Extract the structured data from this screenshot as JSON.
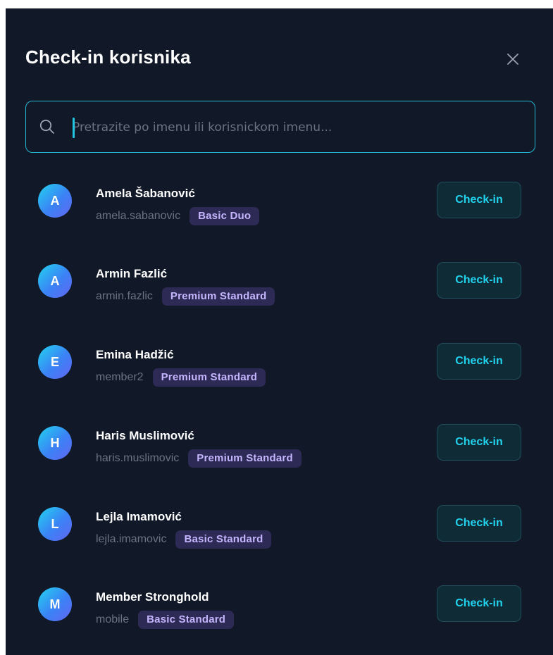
{
  "modal": {
    "title": "Check-in korisnika",
    "close_icon": "close-icon"
  },
  "search": {
    "placeholder": "Pretrazite po imenu ili korisnickom imenu...",
    "value": "",
    "icon": "search-icon"
  },
  "colors": {
    "background": "#111827",
    "accent": "#22d3ee",
    "badge_bg": "#2d2a55",
    "badge_text": "#c4b5fd"
  },
  "checkin_label": "Check-in",
  "users": [
    {
      "initial": "A",
      "name": "Amela Šabanović",
      "username": "amela.sabanovic",
      "plan": "Basic Duo"
    },
    {
      "initial": "A",
      "name": "Armin Fazlić",
      "username": "armin.fazlic",
      "plan": "Premium Standard"
    },
    {
      "initial": "E",
      "name": "Emina Hadžić",
      "username": "member2",
      "plan": "Premium Standard"
    },
    {
      "initial": "H",
      "name": "Haris Muslimović",
      "username": "haris.muslimovic",
      "plan": "Premium Standard"
    },
    {
      "initial": "L",
      "name": "Lejla Imamović",
      "username": "lejla.imamovic",
      "plan": "Basic Standard"
    },
    {
      "initial": "M",
      "name": "Member Stronghold",
      "username": "mobile",
      "plan": "Basic Standard"
    }
  ]
}
